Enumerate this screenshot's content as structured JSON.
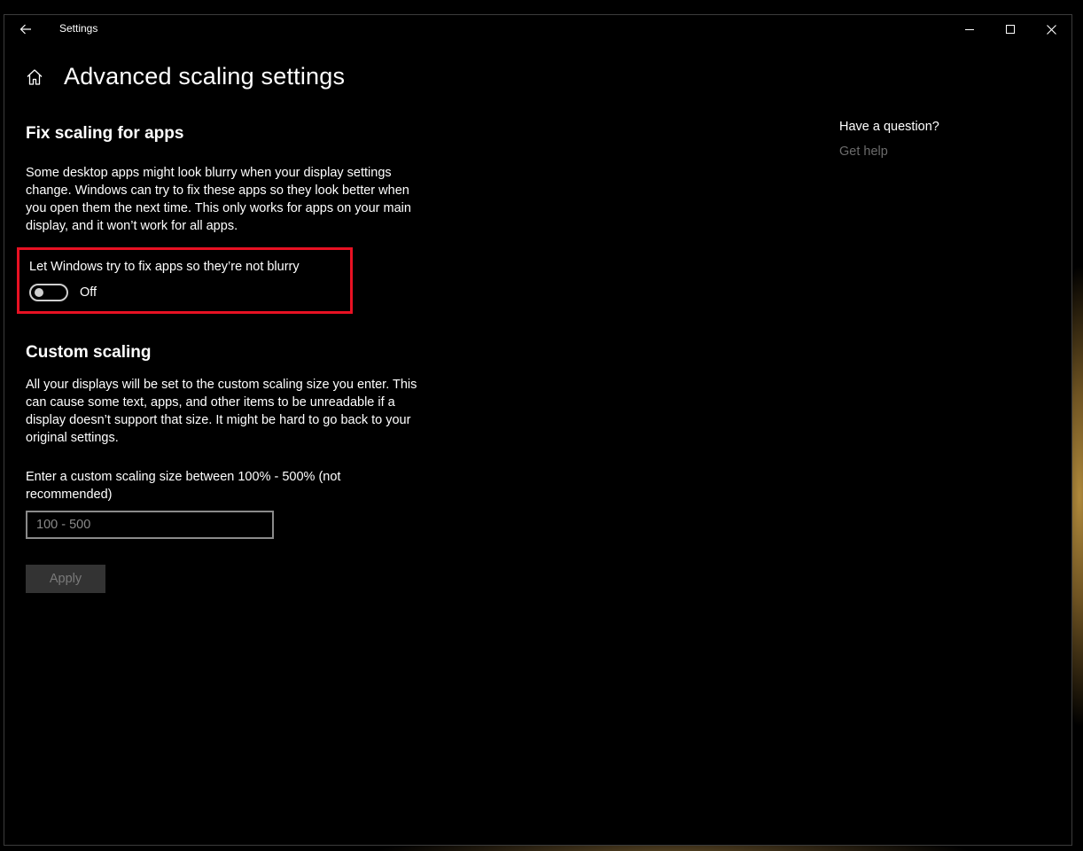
{
  "colors": {
    "background": "#000000",
    "highlight_border": "#e81123",
    "link_disabled": "#6b6b6b",
    "button_disabled_bg": "#333333"
  },
  "titlebar": {
    "title": "Settings",
    "back_icon": "arrow-left-icon",
    "minimize_icon": "minimize-icon",
    "maximize_icon": "maximize-icon",
    "close_icon": "close-icon"
  },
  "header": {
    "home_icon": "home-icon",
    "title": "Advanced scaling settings"
  },
  "fix_scaling": {
    "title": "Fix scaling for apps",
    "description": "Some desktop apps might look blurry when your display settings change. Windows can try to fix these apps so they look better when you open them the next time. This only works for apps on your main display, and it won’t work for all apps.",
    "toggle_label": "Let Windows try to fix apps so they’re not blurry",
    "toggle_state": "Off"
  },
  "custom_scaling": {
    "title": "Custom scaling",
    "description": "All your displays will be set to the custom scaling size you enter. This can cause some text, apps, and other items to be unreadable if a display doesn’t support that size. It might be hard to go back to your original settings.",
    "input_label": "Enter a custom scaling size between 100% - 500% (not recommended)",
    "input_placeholder": "100 - 500",
    "input_value": "",
    "apply_label": "Apply"
  },
  "side": {
    "question_title": "Have a question?",
    "help_link": "Get help"
  }
}
